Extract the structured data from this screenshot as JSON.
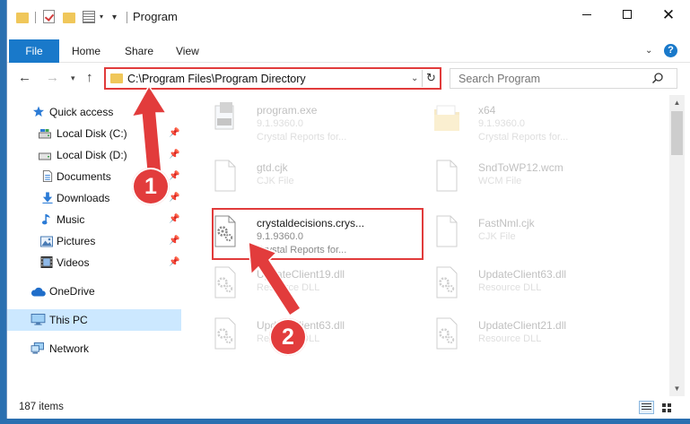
{
  "window": {
    "title": "Program",
    "buttons": {
      "minimize": "minimize",
      "maximize": "maximize",
      "close": "✕"
    }
  },
  "ribbon": {
    "tabs": [
      "File",
      "Home",
      "Share",
      "View"
    ],
    "help": "?"
  },
  "navigation": {
    "address": "C:\\Program Files\\Program Directory",
    "search_placeholder": "Search Program"
  },
  "nav_pane": {
    "items": [
      {
        "label": "Quick access",
        "icon": "star-icon"
      },
      {
        "label": "Local Disk (C:)",
        "icon": "drive-icon",
        "pinned": true
      },
      {
        "label": "Local Disk (D:)",
        "icon": "drive-icon",
        "pinned": true
      },
      {
        "label": "Documents",
        "icon": "documents-icon",
        "pinned": true
      },
      {
        "label": "Downloads",
        "icon": "download-icon",
        "pinned": true
      },
      {
        "label": "Music",
        "icon": "music-icon",
        "pinned": true
      },
      {
        "label": "Pictures",
        "icon": "pictures-icon",
        "pinned": true
      },
      {
        "label": "Videos",
        "icon": "videos-icon",
        "pinned": true
      },
      {
        "label": "OneDrive",
        "icon": "cloud-icon"
      },
      {
        "label": "This PC",
        "icon": "computer-icon",
        "selected": true
      },
      {
        "label": "Network",
        "icon": "network-icon"
      }
    ]
  },
  "files": [
    {
      "name": "program.exe",
      "line2": "9.1.9360.0",
      "line3": "Crystal Reports for...",
      "icon": "exe-icon"
    },
    {
      "name": "x64",
      "line2": "9.1.9360.0",
      "line3": "Crystal Reports for...",
      "icon": "folder-icon"
    },
    {
      "name": "gtd.cjk",
      "line2": "CJK File",
      "line3": "",
      "icon": "document-icon"
    },
    {
      "name": "SndToWP12.wcm",
      "line2": "WCM File",
      "line3": "",
      "icon": "document-icon"
    },
    {
      "name": "crystaldecisions.crys...",
      "line2": "9.1.9360.0",
      "line3": "Crystal Reports for...",
      "icon": "dll-gear-icon",
      "highlighted": true
    },
    {
      "name": "FastNml.cjk",
      "line2": "CJK File",
      "line3": "",
      "icon": "document-icon"
    },
    {
      "name": "UpdateClient19.dll",
      "line2": "Resource DLL",
      "line3": "",
      "icon": "dll-gear-icon"
    },
    {
      "name": "UpdateClient63.dll",
      "line2": "Resource DLL",
      "line3": "",
      "icon": "dll-gear-icon"
    },
    {
      "name": "UpdateClient63.dll",
      "line2": "Resource DLL",
      "line3": "",
      "icon": "dll-gear-icon"
    },
    {
      "name": "UpdateClient21.dll",
      "line2": "Resource DLL",
      "line3": "",
      "icon": "dll-gear-icon"
    }
  ],
  "status": {
    "items_count": "187 items"
  },
  "callouts": [
    "1",
    "2"
  ],
  "colors": {
    "accent": "#1979ca",
    "selection": "#cce8ff",
    "callout": "#e23c3c"
  }
}
